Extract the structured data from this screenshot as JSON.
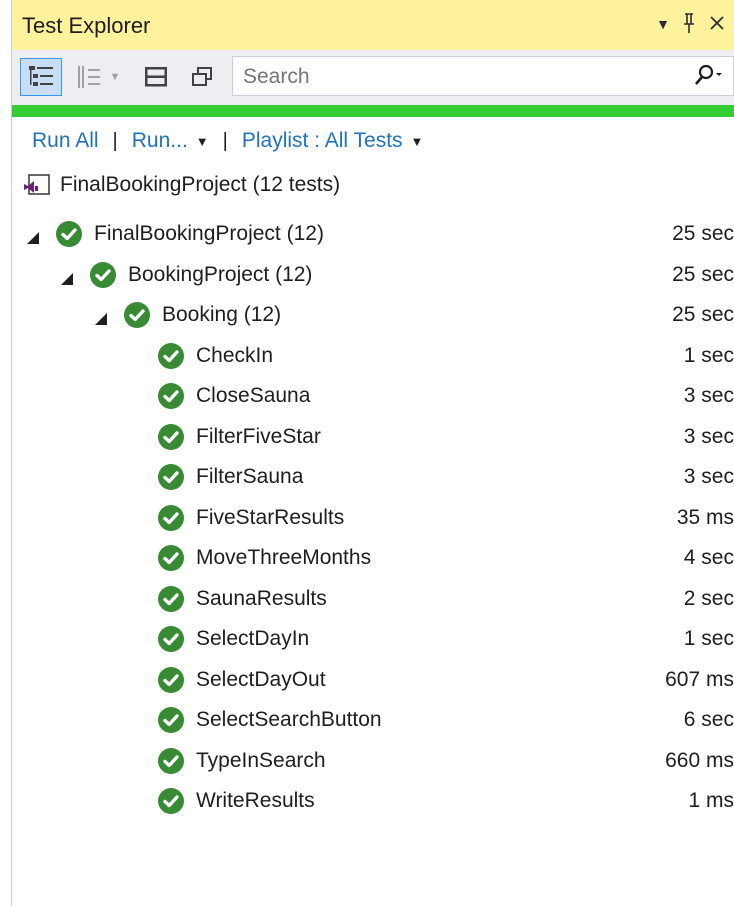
{
  "window": {
    "title": "Test Explorer",
    "controls": [
      "▾",
      "⊥",
      "✕"
    ]
  },
  "search": {
    "placeholder": "Search"
  },
  "actions": {
    "run_all": "Run All",
    "run": "Run...",
    "playlist": "Playlist : All Tests"
  },
  "project": {
    "label": "FinalBookingProject (12 tests)"
  },
  "tree": [
    {
      "name": "FinalBookingProject (12)",
      "duration": "25 sec",
      "level": 0,
      "expandable": true
    },
    {
      "name": "BookingProject (12)",
      "duration": "25 sec",
      "level": 1,
      "expandable": true
    },
    {
      "name": "Booking (12)",
      "duration": "25 sec",
      "level": 2,
      "expandable": true
    },
    {
      "name": "CheckIn",
      "duration": "1 sec",
      "level": 3,
      "expandable": false
    },
    {
      "name": "CloseSauna",
      "duration": "3 sec",
      "level": 3,
      "expandable": false
    },
    {
      "name": "FilterFiveStar",
      "duration": "3 sec",
      "level": 3,
      "expandable": false
    },
    {
      "name": "FilterSauna",
      "duration": "3 sec",
      "level": 3,
      "expandable": false
    },
    {
      "name": "FiveStarResults",
      "duration": "35 ms",
      "level": 3,
      "expandable": false
    },
    {
      "name": "MoveThreeMonths",
      "duration": "4 sec",
      "level": 3,
      "expandable": false
    },
    {
      "name": "SaunaResults",
      "duration": "2 sec",
      "level": 3,
      "expandable": false
    },
    {
      "name": "SelectDayIn",
      "duration": "1 sec",
      "level": 3,
      "expandable": false
    },
    {
      "name": "SelectDayOut",
      "duration": "607 ms",
      "level": 3,
      "expandable": false
    },
    {
      "name": "SelectSearchButton",
      "duration": "6 sec",
      "level": 3,
      "expandable": false
    },
    {
      "name": "TypeInSearch",
      "duration": "660 ms",
      "level": 3,
      "expandable": false
    },
    {
      "name": "WriteResults",
      "duration": "1 ms",
      "level": 3,
      "expandable": false
    }
  ],
  "colors": {
    "title_bar": "#fff29d",
    "toolbar": "#eeeef2",
    "pass_bar": "#33cc33",
    "pass_icon": "#388a34",
    "link": "#1e73be"
  },
  "icons": [
    "group-by-icon",
    "sort-icon",
    "expand-collapse-icon",
    "copy-icon",
    "search-icon",
    "vs-project-icon",
    "passed-check-icon",
    "tree-expander-icon"
  ]
}
